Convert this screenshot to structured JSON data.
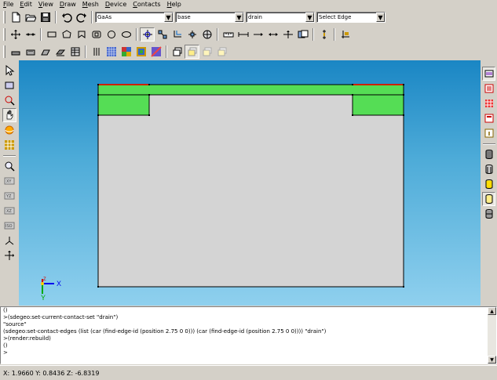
{
  "menu": [
    {
      "key": "F",
      "rest": "ile"
    },
    {
      "key": "E",
      "rest": "dit"
    },
    {
      "key": "V",
      "rest": "iew"
    },
    {
      "key": "D",
      "rest": "raw"
    },
    {
      "key": "M",
      "rest": "esh"
    },
    {
      "key": "D",
      "rest": "evice"
    },
    {
      "key": "C",
      "rest": "ontacts"
    },
    {
      "key": "H",
      "rest": "elp"
    }
  ],
  "toolbar1": {
    "material": "GaAs",
    "region": "base",
    "contact": "drain",
    "selection_mode": "Select Edge"
  },
  "console": {
    "lines": [
      "()",
      ">(sdegeo:set-current-contact-set \"drain\")",
      "\"source\"",
      "(sdegeo:set-contact-edges (list (car (find-edge-id (position 2.75 0 0))) (car (find-edge-id (position 2.75 0 0)))) \"drain\")",
      "",
      ">(render:rebuild)",
      "()",
      ">"
    ]
  },
  "status": {
    "coords": "X: 1.9660 Y: 0.8436 Z: -6.8319"
  },
  "axes": {
    "x": "X",
    "y": "Y",
    "z": "Z"
  },
  "colors": {
    "viewport_top": "#1a86c4",
    "viewport_bottom": "#8fd0ee",
    "substrate": "#d4d4d4",
    "layer": "#55dd55",
    "contact": "#cc2200"
  },
  "icons": {
    "left": [
      "select-arrow-icon",
      "select-rect-icon",
      "zoom-box-icon",
      "pan-hand-icon",
      "orbit-icon",
      "grid-icon",
      "zoom-icon",
      "view-xy-icon",
      "view-yz-icon",
      "view-xz-icon",
      "view-iso-icon",
      "perspective-icon",
      "reset-view-icon"
    ],
    "right": [
      "region-list-icon",
      "material-list-icon",
      "mesh-list-icon",
      "contact-list-icon",
      "info-icon",
      "cylinder-gray-icon",
      "cylinder-outline-icon",
      "cylinder-yellow-icon",
      "cylinder-selected-icon",
      "cylinder-dark-icon"
    ]
  }
}
